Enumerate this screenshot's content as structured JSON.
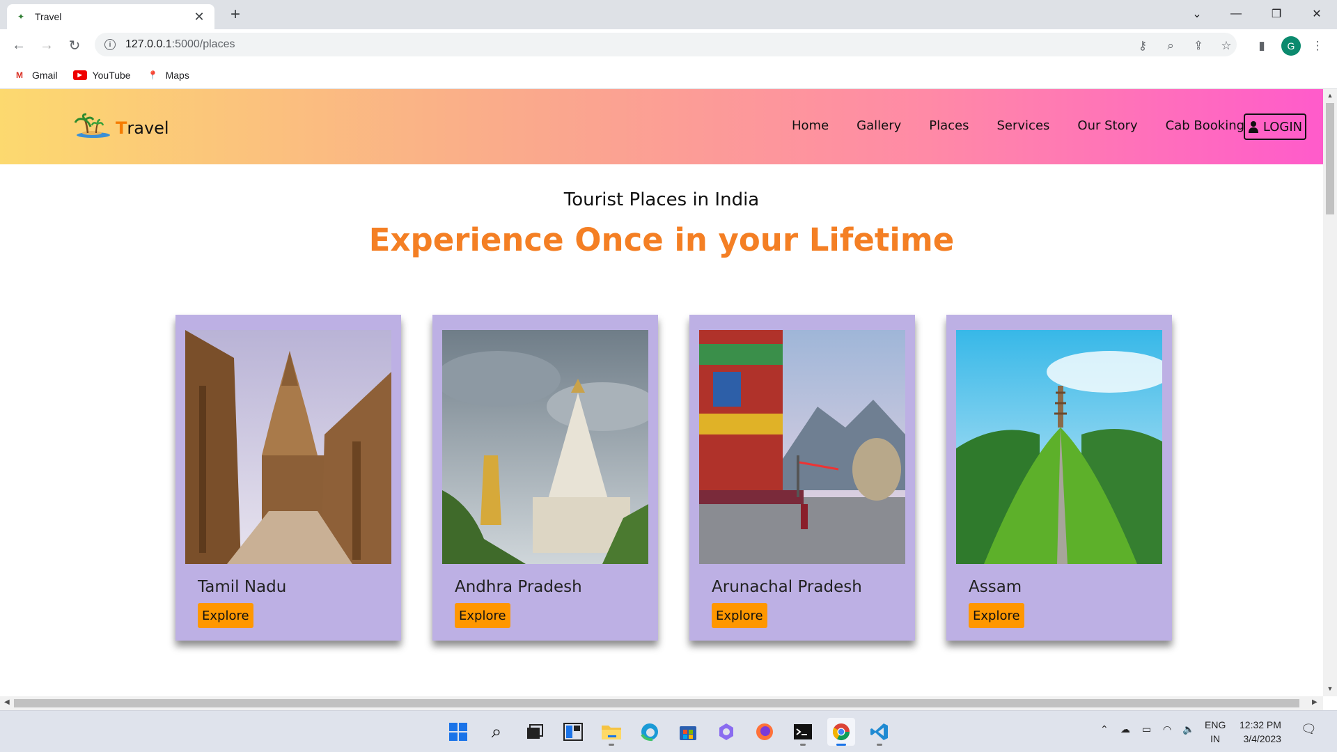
{
  "browser": {
    "tab_title": "Travel",
    "url_host": "127.0.0.1",
    "url_path": ":5000/places",
    "avatar_letter": "G",
    "bookmarks": [
      {
        "label": "Gmail",
        "icon": "gmail-icon"
      },
      {
        "label": "YouTube",
        "icon": "youtube-icon"
      },
      {
        "label": "Maps",
        "icon": "maps-icon"
      }
    ]
  },
  "site": {
    "brand_initial": "T",
    "brand_rest": "ravel",
    "nav": [
      "Home",
      "Gallery",
      "Places",
      "Services",
      "Our Story",
      "Cab Booking"
    ],
    "login_label": "LOGIN",
    "subtitle": "Tourist Places in India",
    "headline": "Experience Once in your Lifetime",
    "cards": [
      {
        "name": "Tamil Nadu",
        "button": "Explore"
      },
      {
        "name": "Andhra Pradesh",
        "button": "Explore"
      },
      {
        "name": "Arunachal Pradesh",
        "button": "Explore"
      },
      {
        "name": "Assam",
        "button": "Explore"
      }
    ],
    "colors": {
      "accent": "#f47f24",
      "card_bg": "#bdb0e4",
      "button": "#ff9700"
    }
  },
  "taskbar": {
    "lang_top": "ENG",
    "lang_bottom": "IN",
    "time": "12:32 PM",
    "date": "3/4/2023"
  }
}
